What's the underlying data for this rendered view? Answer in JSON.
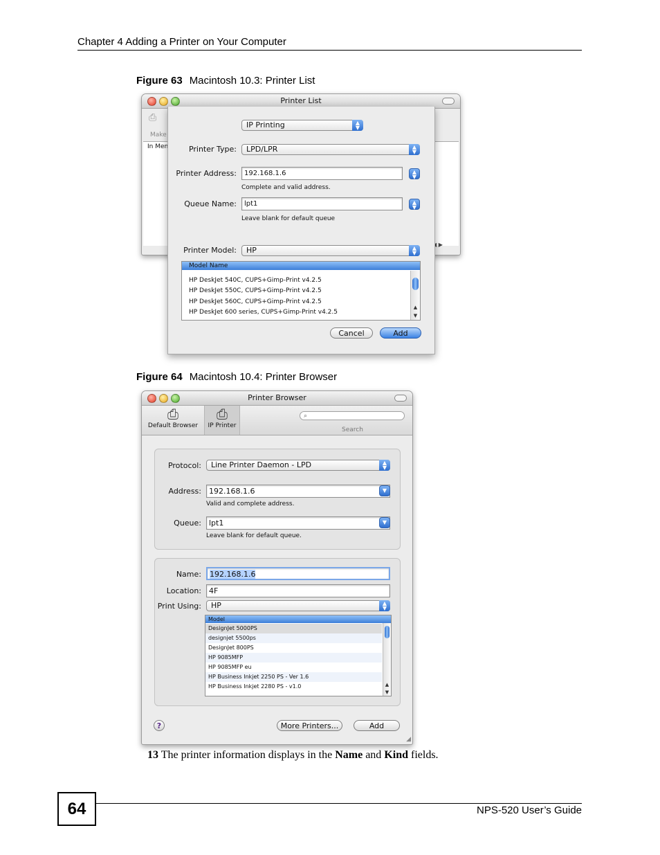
{
  "header": {
    "chapter": "Chapter 4 Adding a Printer on Your Computer"
  },
  "figure63": {
    "number": "Figure 63",
    "caption": "Macintosh 10.3: Printer List",
    "window_title": "Printer List",
    "bg_fragments": {
      "make": "Make",
      "in_menu": "In Men"
    },
    "connection_popup": "IP Printing",
    "printer_type_label": "Printer Type:",
    "printer_type_value": "LPD/LPR",
    "printer_address_label": "Printer Address:",
    "printer_address_value": "192.168.1.6",
    "address_hint": "Complete and valid address.",
    "queue_name_label": "Queue Name:",
    "queue_name_value": "lpt1",
    "queue_hint": "Leave blank for default queue",
    "printer_model_label": "Printer Model:",
    "printer_model_value": "HP",
    "model_list_header": "Model Name",
    "models": [
      "HP DeskJet 540C, CUPS+Gimp-Print v4.2.5",
      "HP DeskJet 550C, CUPS+Gimp-Print v4.2.5",
      "HP DeskJet 560C, CUPS+Gimp-Print v4.2.5",
      "HP DeskJet 600 series, CUPS+Gimp-Print v4.2.5"
    ],
    "cancel_label": "Cancel",
    "add_label": "Add"
  },
  "figure64": {
    "number": "Figure 64",
    "caption": "Macintosh 10.4: Printer Browser",
    "window_title": "Printer Browser",
    "toolbar": {
      "default_browser": "Default Browser",
      "ip_printer": "IP Printer",
      "search": "Search"
    },
    "protocol_label": "Protocol:",
    "protocol_value": "Line Printer Daemon - LPD",
    "address_label": "Address:",
    "address_value": "192.168.1.6",
    "address_hint": "Valid and complete address.",
    "queue_label": "Queue:",
    "queue_value": "lpt1",
    "queue_hint": "Leave blank for default queue.",
    "name_label": "Name:",
    "name_value": "192.168.1.6",
    "location_label": "Location:",
    "location_value": "4F",
    "print_using_label": "Print Using:",
    "print_using_value": "HP",
    "model_list_header": "Model",
    "models": [
      "DesignJet 5000PS",
      "designjet 5500ps",
      "DesignJet 800PS",
      "HP 9085MFP",
      "HP 9085MFP eu",
      "HP Business Inkjet 2250 PS - Ver 1.6",
      "HP Business Inkjet 2280 PS - v1.0"
    ],
    "help_label": "?",
    "more_printers_label": "More Printers...",
    "add_label": "Add"
  },
  "step": {
    "number": "13",
    "text_before": " The printer information displays in the ",
    "bold1": "Name",
    "and": " and ",
    "bold2": "Kind",
    "text_after": " fields."
  },
  "footer": {
    "page_number": "64",
    "guide": "NPS-520 User’s Guide"
  }
}
